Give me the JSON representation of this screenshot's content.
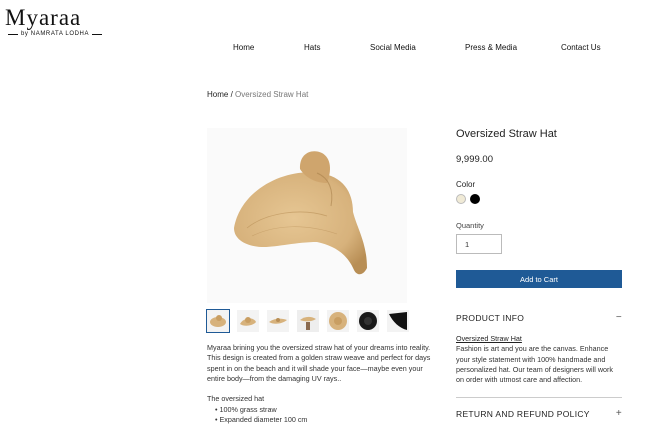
{
  "brand": {
    "name": "Myaraa",
    "tagline": "by NAMRATA LODHA"
  },
  "nav": {
    "items": [
      "Home",
      "Hats",
      "Social Media",
      "Press & Media",
      "Contact Us"
    ]
  },
  "breadcrumb": {
    "home": "Home",
    "separator": " / ",
    "current": "Oversized Straw Hat"
  },
  "gallery": {
    "thumbnails": [
      "straw-hat-front",
      "straw-hat-side",
      "straw-hat-flat",
      "straw-hat-model",
      "straw-hat-top",
      "black-hat-top",
      "black-hat-side"
    ]
  },
  "description": {
    "intro": "Myaraa brining you the oversized straw hat of your dreams into reality. This design is created from a golden straw weave and perfect for days spent in on the beach and it will shade your face—maybe even your entire body—from the damaging UV rays..",
    "list_title": "The oversized hat",
    "list": [
      "100% grass straw",
      "Expanded diameter 100 cm"
    ]
  },
  "product": {
    "title": "Oversized Straw Hat",
    "price": "9,999.00",
    "color_label": "Color",
    "colors": [
      "#f0ead6",
      "#000000"
    ],
    "quantity_label": "Quantity",
    "quantity_value": "1",
    "add_to_cart": "Add to Cart"
  },
  "info": {
    "header": "PRODUCT INFO",
    "toggle": "−",
    "subtitle": "Oversized Straw Hat",
    "body": "Fashion is art and you are the canvas. Enhance your style statement with 100% handmade and personalized hat. Our team of designers will work on order with utmost care and affection."
  },
  "refund": {
    "header": "RETURN AND REFUND POLICY",
    "toggle": "+"
  },
  "colors": {
    "accent": "#1f5a96",
    "straw": "#d7b27c",
    "straw_dark": "#b88e55"
  }
}
